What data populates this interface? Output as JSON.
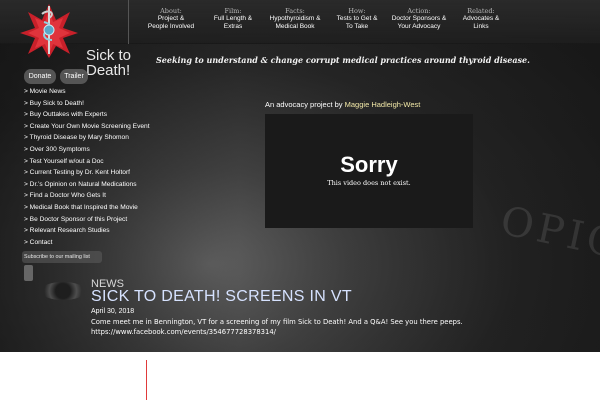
{
  "header": {
    "title_line1": "Sick to",
    "title_line2": "Death!",
    "tagline": "Seeking to understand & change corrupt medical practices around thyroid disease."
  },
  "nav": [
    {
      "category": "About:",
      "line1": "Project &",
      "line2": "People Involved"
    },
    {
      "category": "Film:",
      "line1": "Full Length &",
      "line2": "Extras"
    },
    {
      "category": "Facts:",
      "line1": "Hypothyroidism &",
      "line2": "Medical Book"
    },
    {
      "category": "How:",
      "line1": "Tests to Get &",
      "line2": "To Take"
    },
    {
      "category": "Action:",
      "line1": "Doctor Sponsors &",
      "line2": "Your Advocacy"
    },
    {
      "category": "Related:",
      "line1": "Advocates &",
      "line2": "Links"
    }
  ],
  "buttons": {
    "donate": "Donate",
    "trailer": "Trailer"
  },
  "sidebar": [
    "> Movie News",
    "> Buy Sick to Death!",
    "> Buy Outtakes with Experts",
    "> Create Your Own Movie Screening Event",
    "> Thyroid Disease by Mary Shomon",
    "> Over 300 Symptoms",
    "> Test Yourself w/out a Doc",
    "> Current Testing by Dr. Kent Holtorf",
    "> Dr.'s Opinion on Natural Medications",
    "> Find a Doctor Who Gets It",
    "> Medical Book that Inspired the Movie",
    "> Be Doctor Sponsor of this Project",
    "> Relevant Research Studies",
    "> Contact"
  ],
  "mailing": {
    "label": "Subscribe to our mailing list"
  },
  "advocacy": {
    "prefix": "An advocacy project by ",
    "author": "Maggie Hadleigh-West"
  },
  "video": {
    "title": "Sorry",
    "message": "This video does not exist."
  },
  "news": {
    "label": "NEWS",
    "headline": "SICK TO DEATH! SCREENS IN VT",
    "date": "April 30, 2018",
    "body": "Come meet me in Bennington, VT for a screening of my film Sick to Death! And a Q&A! See you there peeps.",
    "link": "https://www.facebook.com/events/354677728378314/"
  },
  "colors": {
    "accent_red": "#c8202a",
    "headline_blue": "#d6e2ff",
    "author_yellow": "#f3e9a8"
  }
}
